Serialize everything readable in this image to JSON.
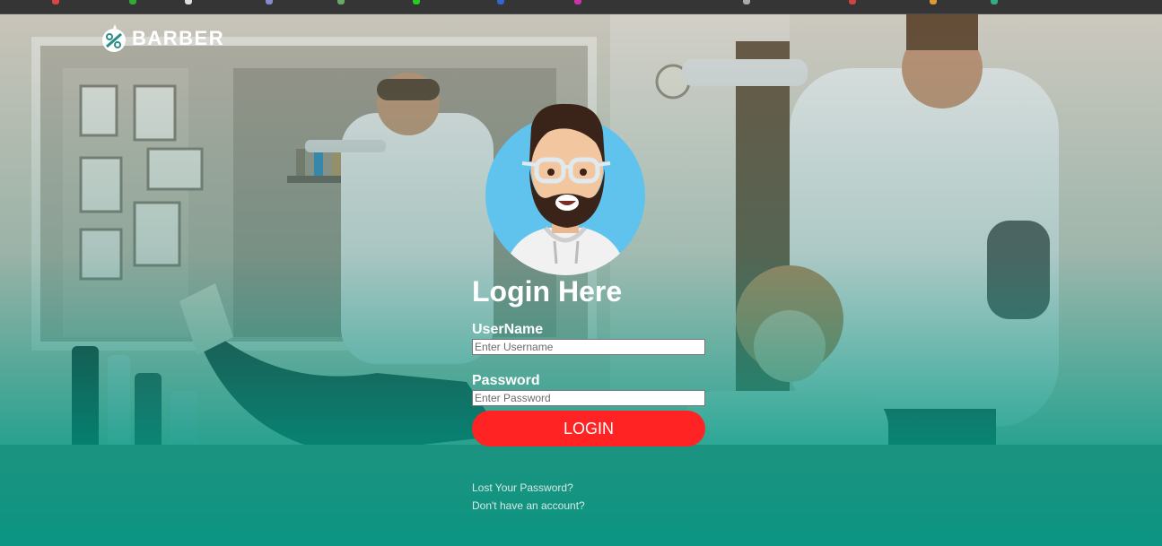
{
  "brand": {
    "name": "BARBER"
  },
  "login": {
    "title": "Login Here",
    "username_label": "UserName",
    "username_placeholder": "Enter Username",
    "password_label": "Password",
    "password_placeholder": "Enter Password",
    "submit_label": "LOGIN",
    "lost_password_link": "Lost Your Password?",
    "signup_link": "Don't have an account?"
  },
  "colors": {
    "accent_button": "#ff2323",
    "overlay_teal": "#009682",
    "avatar_circle": "#5fc3ee"
  },
  "icons": [
    "barber-logo-icon",
    "user-avatar-icon"
  ]
}
